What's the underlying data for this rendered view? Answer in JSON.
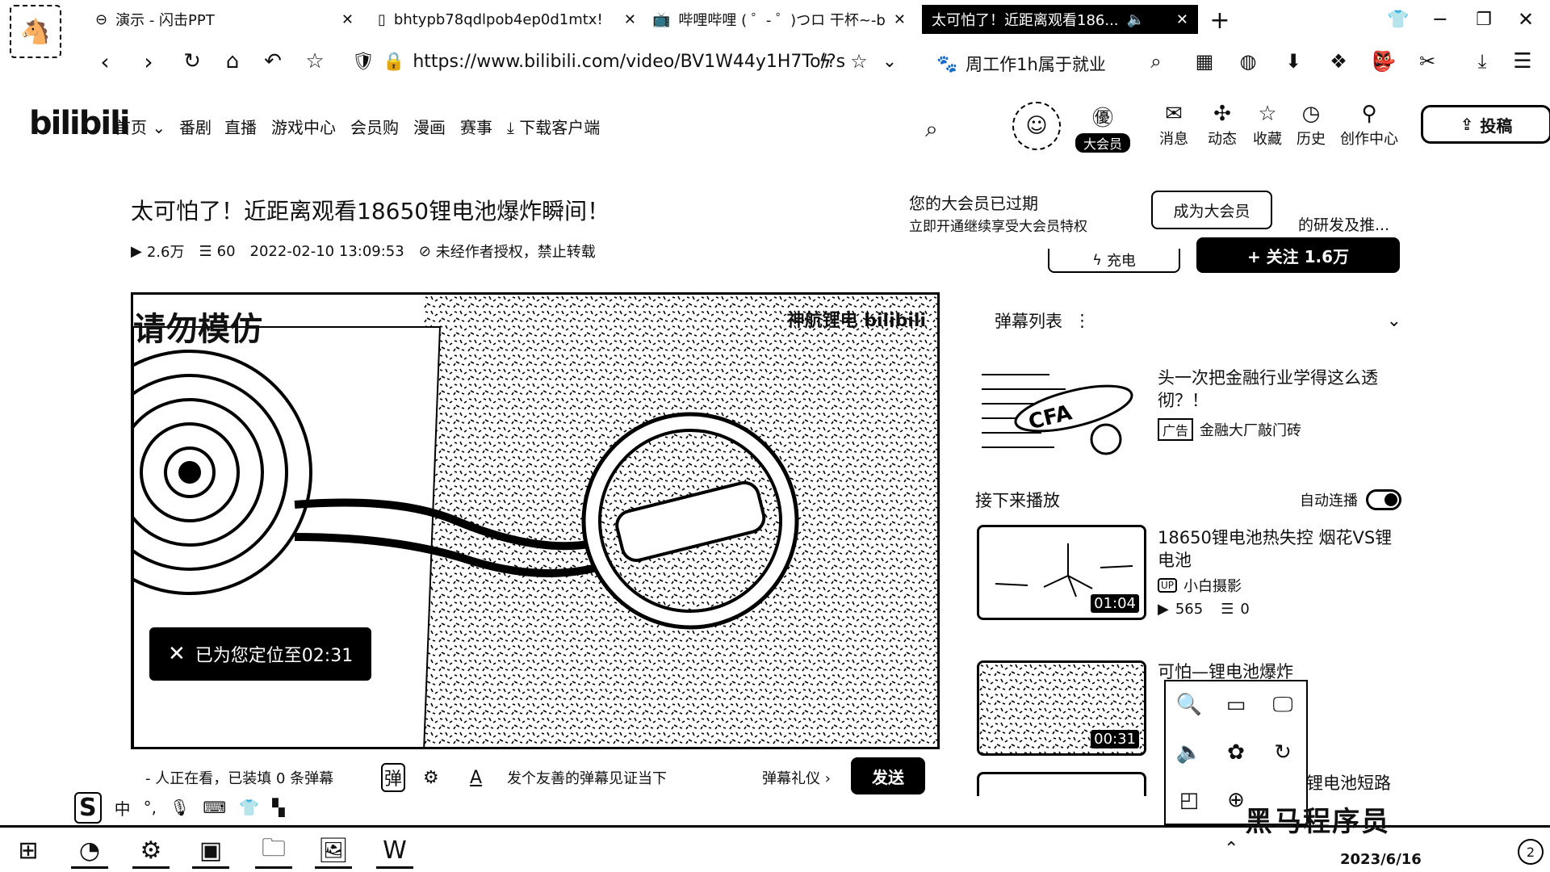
{
  "browser": {
    "tabs": [
      {
        "label": "演示 - 闪击PPT",
        "icon": "link-icon"
      },
      {
        "label": "bhtypb78qdlpob4ep0d1mtx!",
        "icon": "doc-icon"
      },
      {
        "label": "哔哩哔哩 ( ゜- ゜)つロ 干杯~-bi",
        "icon": "tv-icon"
      },
      {
        "label": "太可怕了！近距离观看186...",
        "icon": "sound-icon",
        "active": true
      }
    ],
    "url": "https://www.bilibili.com/video/BV1W44y1H7To/?s",
    "search_hint": "周工作1h属于就业"
  },
  "header": {
    "logo": "bilibili",
    "nav": [
      "首页",
      "番剧",
      "直播",
      "游戏中心",
      "会员购",
      "漫画",
      "赛事",
      "下载客户端"
    ],
    "vip_badge": "大会员",
    "actions": [
      "消息",
      "动态",
      "收藏",
      "历史",
      "创作中心"
    ],
    "upload": "投稿"
  },
  "video": {
    "title": "太可怕了！近距离观看18650锂电池爆炸瞬间！",
    "views": "2.6万",
    "danmaku_count": "60",
    "date": "2022-02-10 13:09:53",
    "copyright": "未经作者授权，禁止转载",
    "overlay_text": "请勿模仿",
    "player_watermark": "神航锂电 bilibili",
    "toast": "已为您定位至02:31"
  },
  "danmaku_bar": {
    "watching": "- 人正在看，已装填 0 条弹幕",
    "placeholder": "发个友善的弹幕见证当下",
    "etiquette": "弹幕礼仪 ›",
    "send": "发送"
  },
  "vip_popup": {
    "title": "您的大会员已过期",
    "subtitle": "立即开通继续享受大会员特权",
    "button": "成为大会员"
  },
  "creator": {
    "desc": "的研发及推...",
    "charge": "充电",
    "follow": "+ 关注 1.6万"
  },
  "sidebar": {
    "danmaku_list": "弹幕列表",
    "ad": {
      "title": "头一次把金融行业学得这么透彻？！",
      "tag": "广告",
      "author": "金融大厂敲门砖"
    },
    "next_label": "接下来播放",
    "autoplay": "自动连播",
    "videos": [
      {
        "title": "18650锂电池热失控 烟花VS锂电池",
        "author": "小白摄影",
        "views": "565",
        "danmaku": "0",
        "duration": "01:04"
      },
      {
        "title": "可怕—锂电池爆炸",
        "duration": "00:31"
      },
      {
        "title": "锂电池短路"
      }
    ]
  },
  "ime": {
    "mode": "中"
  },
  "taskbar": {
    "date": "2023/6/16",
    "tray_text": "黑马程序员"
  }
}
